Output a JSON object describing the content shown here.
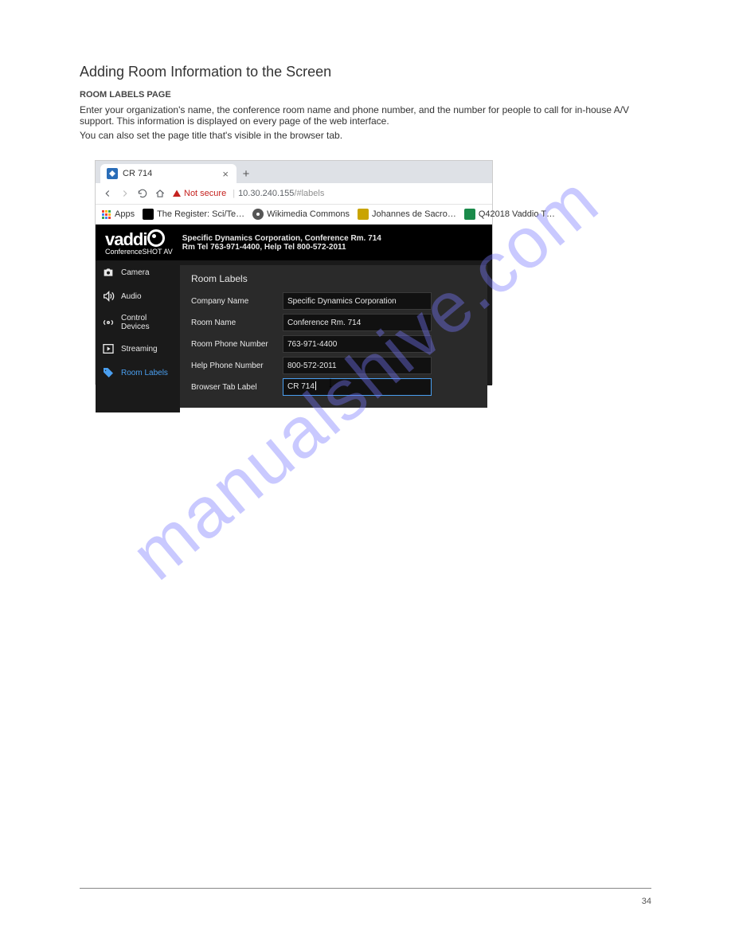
{
  "watermark": "manualshive.com",
  "doc": {
    "title": "Adding Room Information to the Screen",
    "sub": "ROOM LABELS PAGE",
    "p1": "Enter your organization's name, the conference room name and phone number, and the number for people to call for in-house A/V support. This information is displayed on every page of the web interface.",
    "p2": "You can also set the page title that's visible in the browser tab."
  },
  "browser": {
    "tab_title": "CR 714",
    "security_text": "Not secure",
    "url_host": "10.30.240.155",
    "url_path": "/#labels",
    "bookmarks": {
      "apps": "Apps",
      "register": "The Register: Sci/Te…",
      "wikimedia": "Wikimedia Commons",
      "johannes": "Johannes de Sacro…",
      "q4": "Q42018 Vaddio T…"
    }
  },
  "header": {
    "brand": "vaddi",
    "product": "ConferenceSHOT AV",
    "line1": "Specific Dynamics Corporation, Conference Rm. 714",
    "line2": "Rm Tel 763-971-4400, Help Tel 800-572-2011"
  },
  "sidebar": {
    "camera": "Camera",
    "audio": "Audio",
    "control": "Control Devices",
    "streaming": "Streaming",
    "labels": "Room Labels"
  },
  "panel": {
    "title": "Room Labels",
    "fields": {
      "company_label": "Company Name",
      "company_value": "Specific Dynamics Corporation",
      "room_label": "Room Name",
      "room_value": "Conference Rm. 714",
      "phone_label": "Room Phone Number",
      "phone_value": "763-971-4400",
      "help_label": "Help Phone Number",
      "help_value": "800-572-2011",
      "tab_label": "Browser Tab Label",
      "tab_value": "CR 714"
    }
  },
  "page_number": "34"
}
